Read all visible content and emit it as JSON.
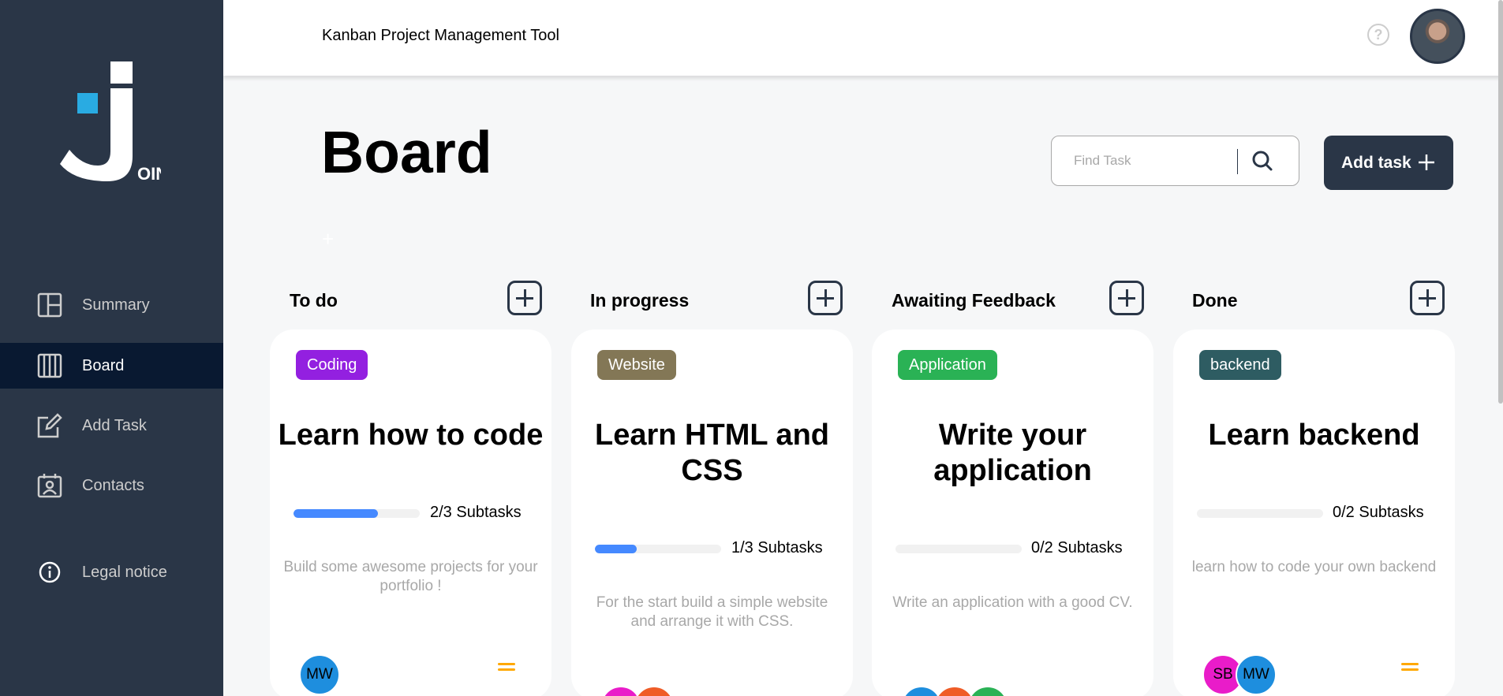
{
  "sidebar": {
    "logo_text": "OIN",
    "nav": [
      {
        "label": "Summary",
        "icon": "summary-icon",
        "active": false
      },
      {
        "label": "Board",
        "icon": "board-icon",
        "active": true
      },
      {
        "label": "Add Task",
        "icon": "add-task-icon",
        "active": false
      },
      {
        "label": "Contacts",
        "icon": "contacts-icon",
        "active": false
      }
    ],
    "legal": {
      "label": "Legal notice",
      "icon": "info-icon"
    }
  },
  "header": {
    "title": "Kanban Project Management Tool",
    "help_symbol": "?"
  },
  "main": {
    "title": "Board",
    "search": {
      "placeholder": "Find Task"
    },
    "add_task_label": "Add task"
  },
  "columns": [
    {
      "title": "To do",
      "card": {
        "category": "Coding",
        "category_color": "#9320e0",
        "title": "Learn how to code",
        "progress": 0.667,
        "subtasks": "2/3 Subtasks",
        "description": "Build some awesome projects for your portfolio !",
        "assignees": [
          {
            "initials": "MW",
            "color": "#1e8ede"
          }
        ],
        "priority": "medium"
      }
    },
    {
      "title": "In progress",
      "card": {
        "category": "Website",
        "category_color": "#837756",
        "title": "Learn HTML and CSS",
        "progress": 0.333,
        "subtasks": "1/3 Subtasks",
        "description": "For the start build a simple website and arrange it with CSS.",
        "assignees": [
          {
            "initials": "",
            "color": "#e91cc9"
          },
          {
            "initials": "",
            "color": "#ef5c27"
          }
        ],
        "priority": "medium"
      }
    },
    {
      "title": "Awaiting Feedback",
      "card": {
        "category": "Application",
        "category_color": "#2ab255",
        "title": "Write your application",
        "progress": 0,
        "subtasks": "0/2 Subtasks",
        "description": "Write an application with a good CV.",
        "assignees": [
          {
            "initials": "",
            "color": "#1e8ede"
          },
          {
            "initials": "",
            "color": "#ef5c27"
          },
          {
            "initials": "",
            "color": "#2ab255"
          }
        ],
        "priority": "medium"
      }
    },
    {
      "title": "Done",
      "card": {
        "category": "backend",
        "category_color": "#2e5c62",
        "title": "Learn backend",
        "progress": 0,
        "subtasks": "0/2 Subtasks",
        "description": "learn how to code your own backend",
        "assignees": [
          {
            "initials": "SB",
            "color": "#e91cc9"
          },
          {
            "initials": "MW",
            "color": "#1e8ede"
          }
        ],
        "priority": "medium"
      }
    }
  ]
}
